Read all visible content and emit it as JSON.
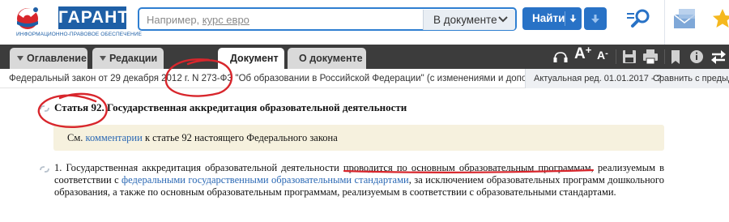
{
  "header": {
    "logo_text": "ГАРАНТ",
    "logo_subtitle": "ИНФОРМАЦИОННО-ПРАВОВОЕ ОБЕСПЕЧЕНИЕ",
    "search": {
      "placeholder_prefix": "Например, ",
      "placeholder_example": "курс евро",
      "value": ""
    },
    "scope_select": {
      "selected": "В документе"
    },
    "find_button": "Найти",
    "icons": {
      "find_arrow": "caret-down-icon",
      "down": "arrow-down-icon",
      "search_list": "search-list-icon",
      "mail": "mail-icon",
      "favorites": "star-icon"
    },
    "accent_color": "#2872c6"
  },
  "tabs": [
    {
      "label": "Оглавление",
      "active": false
    },
    {
      "label": "Редакции",
      "active": false
    },
    {
      "label": "Документ",
      "active": true
    },
    {
      "label": "О документе",
      "active": false
    }
  ],
  "toolbar": {
    "font_increase": "A",
    "font_increase_sup": "+",
    "font_decrease": "A",
    "font_decrease_sup": "-",
    "icons": [
      "tts-icon",
      "font-increase-icon",
      "font-decrease-icon",
      "save-icon",
      "print-icon",
      "bookmark-icon",
      "info-icon",
      "swap-icon"
    ]
  },
  "doc_info": {
    "title": "Федеральный закон от 29 декабря 2012 г. N 273-ФЗ \"Об образовании в Российской Федерации\" (с изменениями и дополнениями)",
    "current_revision": "Актуальная ред. 01.01.2017 - ?",
    "compare": "Сравнить с предыдущ"
  },
  "document": {
    "article_number": "Статья 92.",
    "article_title": "Государственная аккредитация образовательной деятельности",
    "note_prefix": "См. ",
    "note_link": "комментарии",
    "note_suffix": " к статье 92 настоящего Федерального закона",
    "para1_start": "1. Государственная аккредитация образовательной деятельности ",
    "para1_underlined": "проводится по основным образовательным программам",
    "para1_middle": ", реализуемым в соответствии с ",
    "para1_link": "федеральными государственными образовательными стандартами",
    "para1_end": ", за исключением образовательных программ дошкольного образования, а также по основным образовательным программам, реализуемым в соответствии с образовательными стандартами."
  },
  "annotation_color": "#d8262c"
}
